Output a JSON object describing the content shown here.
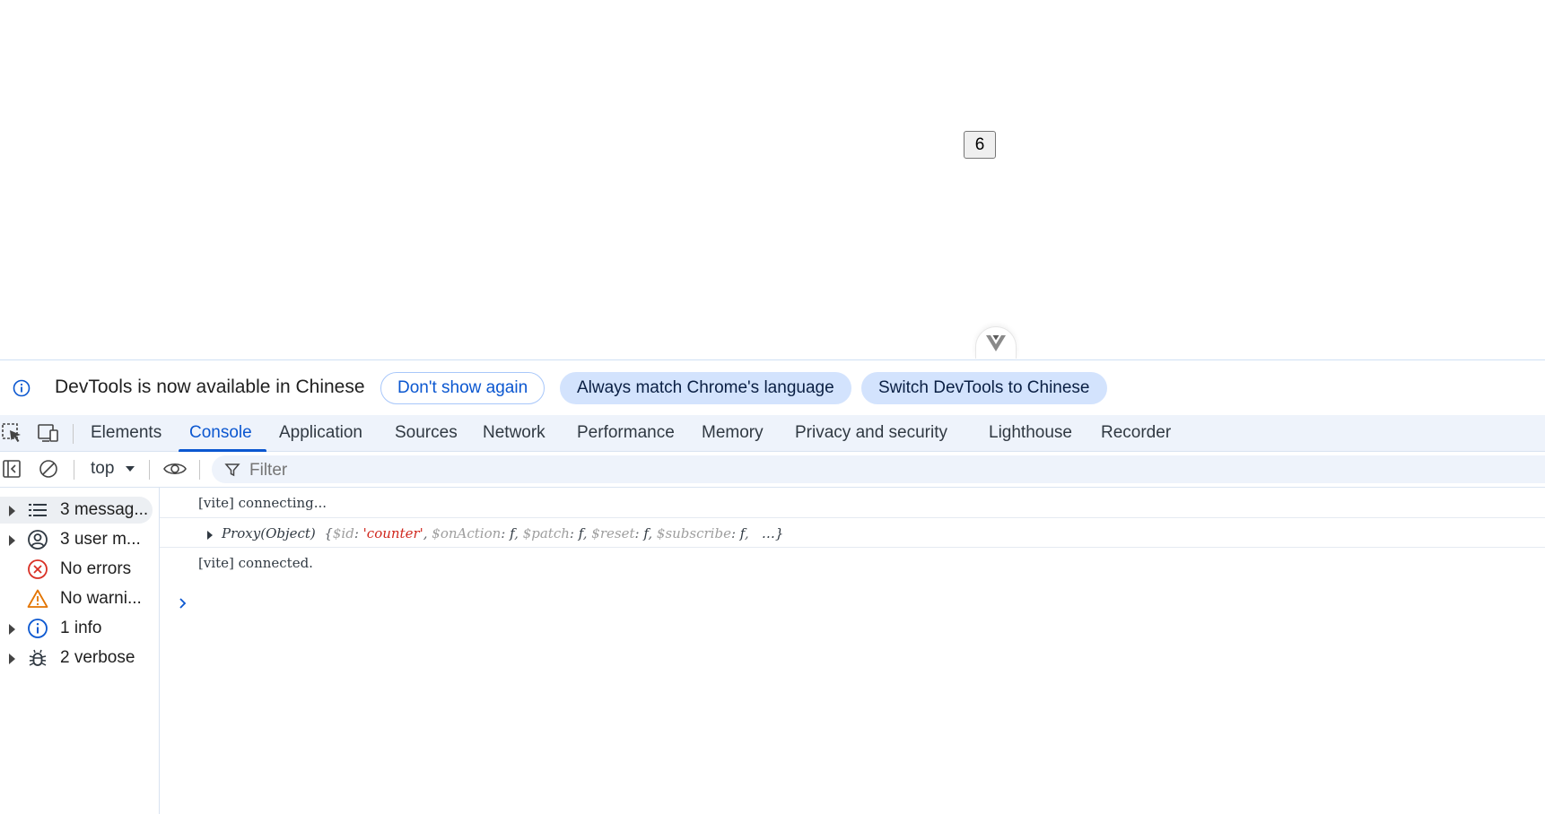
{
  "page": {
    "counter_value": "6"
  },
  "infobar": {
    "message": "DevTools is now available in Chinese",
    "dont_show_again": "Don't show again",
    "always_match": "Always match Chrome's language",
    "switch_language": "Switch DevTools to Chinese"
  },
  "tabs": [
    {
      "label": "Elements"
    },
    {
      "label": "Console"
    },
    {
      "label": "Application"
    },
    {
      "label": "Sources"
    },
    {
      "label": "Network"
    },
    {
      "label": "Performance"
    },
    {
      "label": "Memory"
    },
    {
      "label": "Privacy and security"
    },
    {
      "label": "Lighthouse"
    },
    {
      "label": "Recorder"
    }
  ],
  "toolbar": {
    "context": "top",
    "filter_placeholder": "Filter"
  },
  "sidebar": {
    "items": [
      {
        "label": "3 messag...",
        "icon": "list-icon"
      },
      {
        "label": "3 user m...",
        "icon": "user-icon"
      },
      {
        "label": "No errors",
        "icon": "error-icon"
      },
      {
        "label": "No warni...",
        "icon": "warning-icon"
      },
      {
        "label": "1 info",
        "icon": "info-icon"
      },
      {
        "label": "2 verbose",
        "icon": "bug-icon"
      }
    ]
  },
  "console": {
    "messages": [
      {
        "text": "[vite] connecting..."
      },
      {
        "proxy_label": "Proxy(Object)",
        "open": "{",
        "k1": "$id",
        "v1": "'counter'",
        "k2": "$onAction",
        "v2": "f",
        "k3": "$patch",
        "v3": "f",
        "k4": "$reset",
        "v4": "f",
        "k5": "$subscribe",
        "v5": "f",
        "more": "…}"
      },
      {
        "text": "[vite] connected."
      }
    ]
  },
  "colors": {
    "accent": "#0b57d0",
    "tonal_button": "#d3e3fd",
    "tabbar_bg": "#eef3fb",
    "error": "#d93025",
    "warning": "#e37400",
    "string": "#d0271d"
  }
}
